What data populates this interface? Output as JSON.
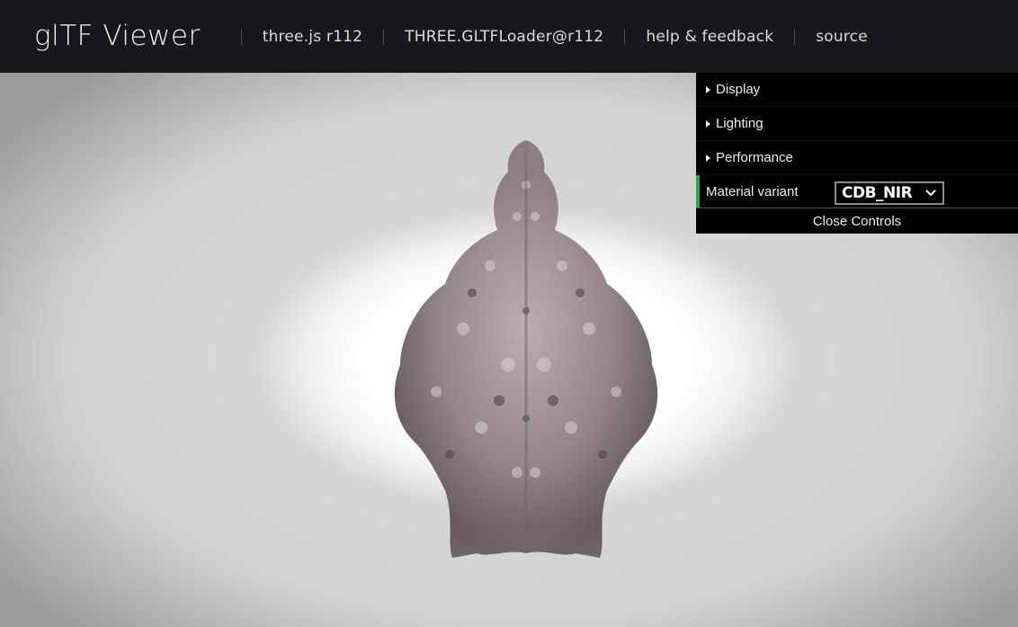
{
  "header": {
    "title": "glTF Viewer",
    "links": [
      {
        "label": "three.js r112"
      },
      {
        "label": "THREE.GLTFLoader@r112"
      },
      {
        "label": "help & feedback"
      },
      {
        "label": "source"
      }
    ]
  },
  "controls": {
    "folders": [
      {
        "label": "Display"
      },
      {
        "label": "Lighting"
      },
      {
        "label": "Performance"
      }
    ],
    "material_variant": {
      "label": "Material variant",
      "value": "CDB_NIR"
    },
    "close_label": "Close Controls"
  },
  "colors": {
    "header_bg": "#16181b",
    "panel_bg": "#000000",
    "accent": "#2fa24f"
  },
  "icons": {
    "folder": "triangle-right-icon",
    "select": "chevron-down-icon"
  }
}
